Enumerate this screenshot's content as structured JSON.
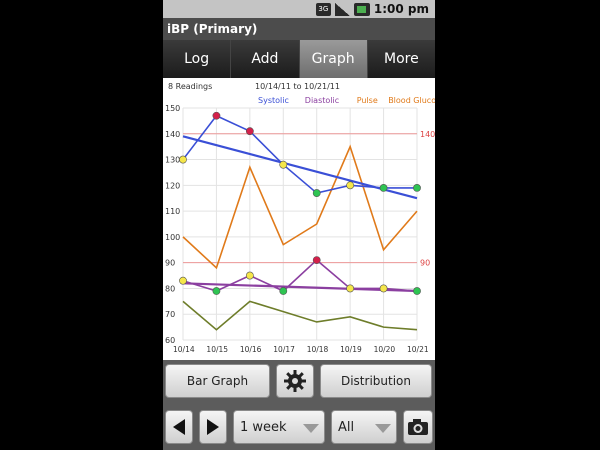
{
  "status_bar": {
    "time": "1:00 pm",
    "network_label": "3G"
  },
  "app": {
    "title": "iBP   (Primary)"
  },
  "tabs": [
    {
      "label": "Log"
    },
    {
      "label": "Add"
    },
    {
      "label": "Graph",
      "selected": true
    },
    {
      "label": "More"
    }
  ],
  "chart_data": {
    "type": "line",
    "readings_label": "8 Readings",
    "date_range": "10/14/11 to 10/21/11",
    "legend": [
      {
        "name": "Systolic",
        "color": "#3a4fd6"
      },
      {
        "name": "Diastolic",
        "color": "#8b3fa0"
      },
      {
        "name": "Pulse",
        "color": "#e07a1a"
      },
      {
        "name": "Blood Glucose",
        "color": "#e07a1a"
      }
    ],
    "x": [
      "10/14",
      "10/15",
      "10/16",
      "10/17",
      "10/18",
      "10/19",
      "10/20",
      "10/21"
    ],
    "ylim": [
      60,
      150
    ],
    "yticks": [
      60,
      70,
      80,
      90,
      100,
      110,
      120,
      130,
      140,
      150
    ],
    "reference_lines": [
      {
        "value": 140,
        "label": "140",
        "color": "#e99"
      },
      {
        "value": 90,
        "label": "90",
        "color": "#e99"
      }
    ],
    "series": [
      {
        "name": "Systolic",
        "color": "#3a4fd6",
        "points": [
          [
            0,
            130
          ],
          [
            1,
            147
          ],
          [
            2,
            141
          ],
          [
            3,
            128
          ],
          [
            4,
            117
          ],
          [
            5,
            120
          ],
          [
            6,
            119
          ],
          [
            7,
            119
          ]
        ],
        "marker_colors": [
          "#f5e64a",
          "#d4204a",
          "#d4204a",
          "#f5e64a",
          "#2ec452",
          "#f5e64a",
          "#2ec452",
          "#2ec452"
        ],
        "trend": [
          139,
          115
        ]
      },
      {
        "name": "Diastolic",
        "color": "#8b3fa0",
        "points": [
          [
            0,
            83
          ],
          [
            1,
            79
          ],
          [
            2,
            85
          ],
          [
            3,
            79
          ],
          [
            4,
            91
          ],
          [
            5,
            80
          ],
          [
            6,
            80
          ],
          [
            7,
            79
          ]
        ],
        "marker_colors": [
          "#f5e64a",
          "#2ec452",
          "#f5e64a",
          "#2ec452",
          "#d4204a",
          "#f5e64a",
          "#f5e64a",
          "#2ec452"
        ],
        "trend": [
          82,
          79
        ]
      },
      {
        "name": "Pulse",
        "color": "#e07a1a",
        "points": [
          [
            0,
            100
          ],
          [
            1,
            88
          ],
          [
            2,
            127
          ],
          [
            3,
            97
          ],
          [
            4,
            105
          ],
          [
            5,
            135
          ],
          [
            6,
            95
          ],
          [
            7,
            110
          ]
        ]
      },
      {
        "name": "Blood Glucose",
        "color": "#6e7d2a",
        "points": [
          [
            0,
            75
          ],
          [
            1,
            64
          ],
          [
            2,
            75
          ],
          [
            3,
            71
          ],
          [
            4,
            67
          ],
          [
            5,
            69
          ],
          [
            6,
            65
          ],
          [
            7,
            64
          ]
        ]
      }
    ]
  },
  "controls": {
    "bar_graph_label": "Bar Graph",
    "distribution_label": "Distribution",
    "period_value": "1 week",
    "filter_value": "All"
  }
}
